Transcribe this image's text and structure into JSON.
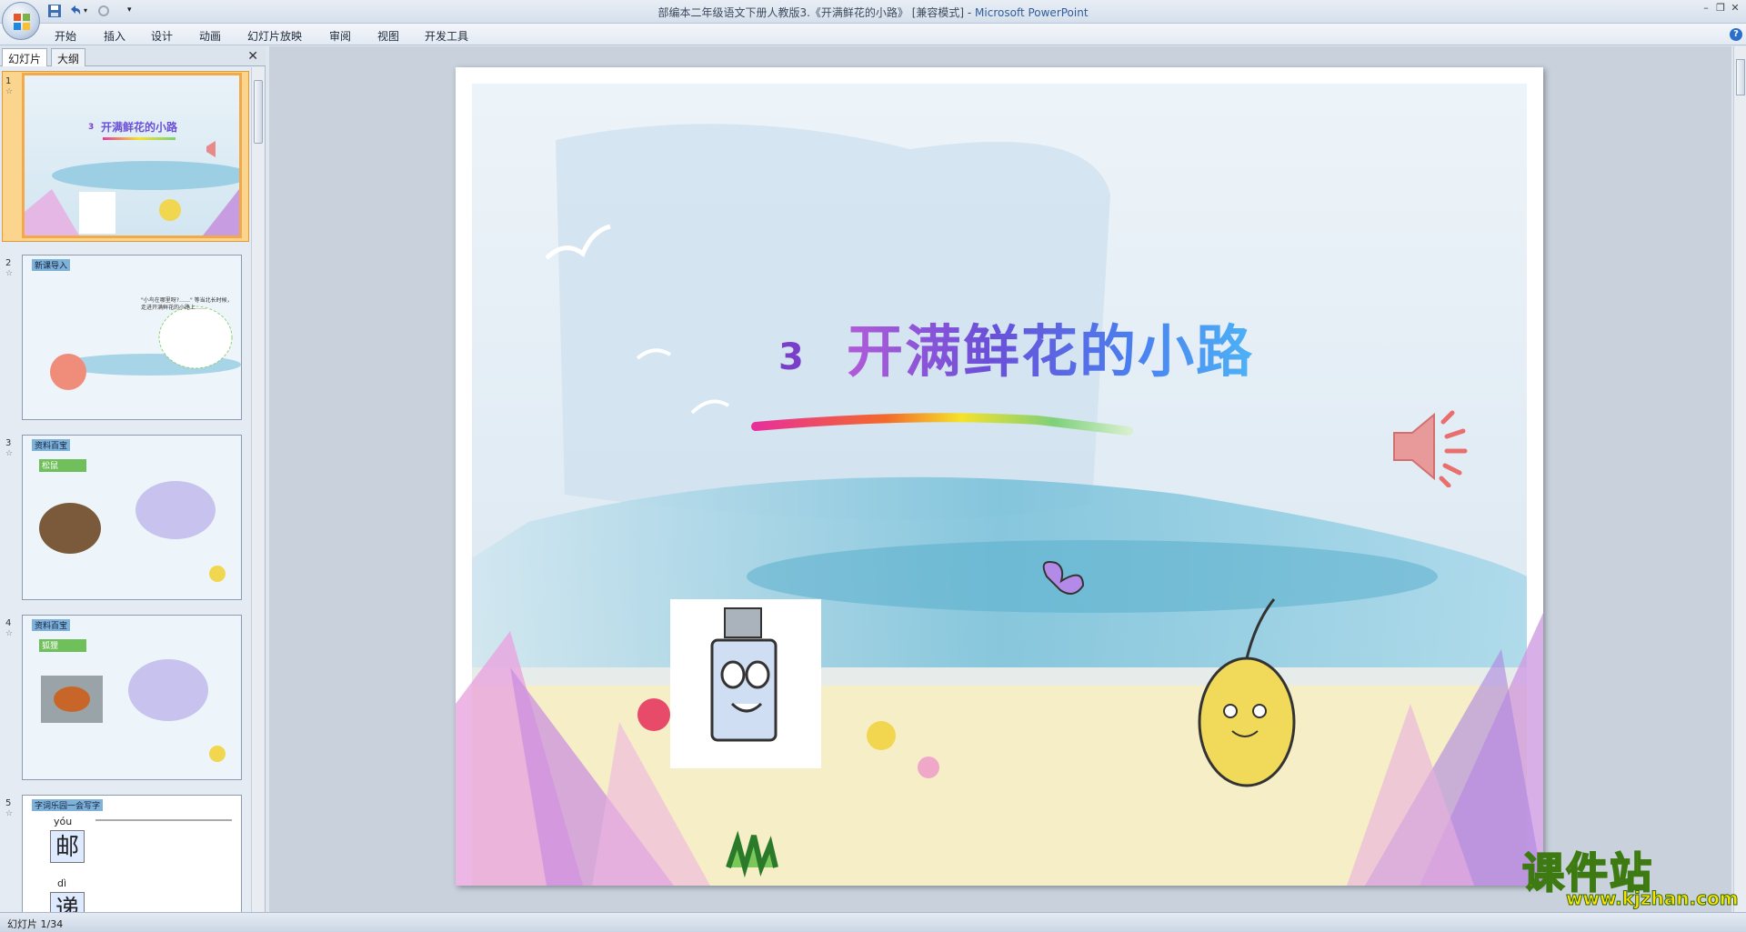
{
  "window": {
    "title": "部编本二年级语文下册人教版3.《开满鲜花的小路》 [兼容模式] -",
    "app_name": "Microsoft PowerPoint"
  },
  "ribbon": {
    "tabs": [
      "开始",
      "插入",
      "设计",
      "动画",
      "幻灯片放映",
      "审阅",
      "视图",
      "开发工具"
    ]
  },
  "left_pane": {
    "tabs": [
      "幻灯片",
      "大纲"
    ],
    "thumbnails": [
      {
        "num": "1",
        "title_num": "3",
        "title": "开满鲜花的小路"
      },
      {
        "num": "2",
        "header": "新课导入",
        "text": "\"小鸟在哪里呀?……\" 等当北长时候，走进开满鲜花的小路上……"
      },
      {
        "num": "3",
        "header": "资料百宝",
        "tag": "松鼠"
      },
      {
        "num": "4",
        "header": "资料百宝",
        "tag": "狐狸"
      },
      {
        "num": "5",
        "header": "字词乐园一会写字",
        "chars": [
          {
            "pinyin": "yóu",
            "char": "邮"
          },
          {
            "pinyin": "dì",
            "char": "递"
          }
        ]
      }
    ]
  },
  "slide": {
    "number": "3",
    "title": "开满鲜花的小路"
  },
  "status": {
    "text": "幻灯片 1/34"
  },
  "watermark": {
    "main": "课件站",
    "url": "www.kjzhan.com"
  },
  "colors": {
    "title_gradient_start": "#b15bd8",
    "title_gradient_end": "#4db3f6",
    "selection": "#fbd48e",
    "watermark_fill": "#f6d10a"
  }
}
